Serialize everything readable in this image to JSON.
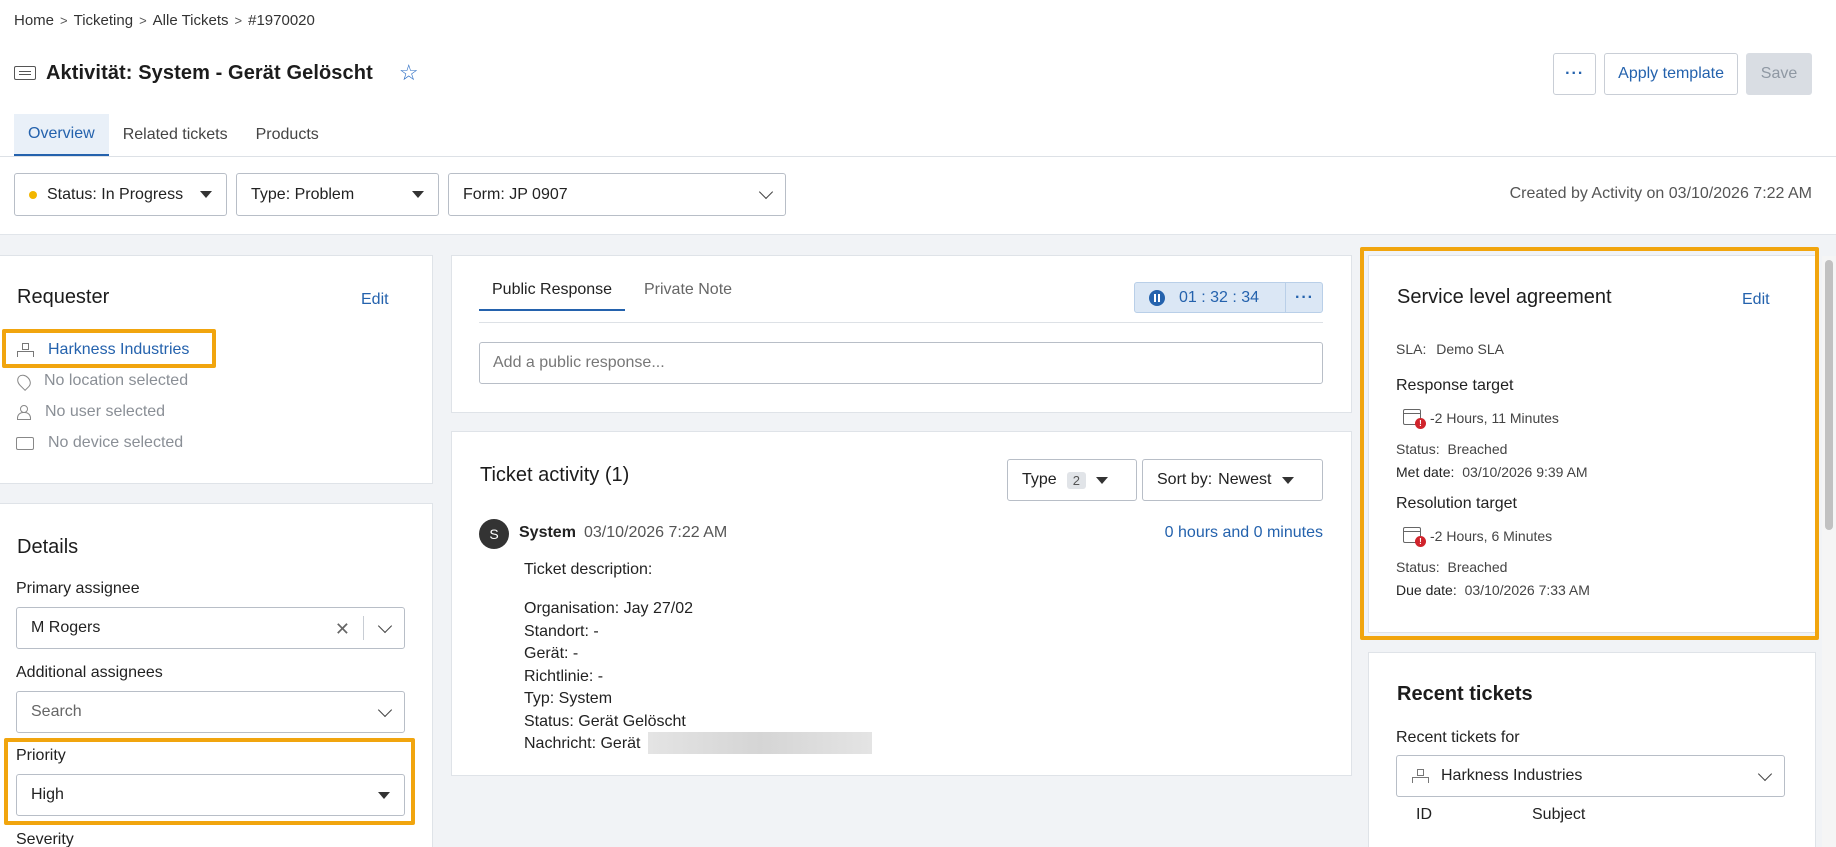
{
  "breadcrumb": [
    "Home",
    "Ticketing",
    "Alle Tickets",
    "#1970020"
  ],
  "title": "Aktivität: System - Gerät Gelöscht",
  "header_buttons": {
    "more": "···",
    "apply_template": "Apply template",
    "save": "Save"
  },
  "tabs": [
    "Overview",
    "Related tickets",
    "Products"
  ],
  "filters": {
    "status": "Status: In Progress",
    "type": "Type: Problem",
    "form": "Form: JP 0907"
  },
  "created_text": "Created by Activity on 03/10/2026 7:22 AM",
  "requester": {
    "heading": "Requester",
    "edit": "Edit",
    "organisation": "Harkness Industries",
    "location": "No location selected",
    "user": "No user selected",
    "device": "No device selected"
  },
  "details": {
    "heading": "Details",
    "primary_label": "Primary assignee",
    "primary_value": "M Rogers",
    "additional_label": "Additional assignees",
    "additional_placeholder": "Search",
    "priority_label": "Priority",
    "priority_value": "High",
    "severity_label": "Severity"
  },
  "response": {
    "tab_public": "Public Response",
    "tab_private": "Private Note",
    "timer": "01 : 32 : 34",
    "timer_more": "···",
    "placeholder": "Add a public response..."
  },
  "activity": {
    "heading": "Ticket activity (1)",
    "type_btn": "Type",
    "type_count": "2",
    "sort_label": "Sort by:",
    "sort_value": "Newest",
    "avatar": "S",
    "author": "System",
    "time": "03/10/2026 7:22 AM",
    "duration": "0 hours and 0 minutes",
    "lines": [
      "Ticket description:",
      "Organisation: Jay 27/02",
      "Standort: -",
      "Gerät: -",
      "Richtlinie: -",
      "Typ: System",
      "Status: Gerät Gelöscht",
      "Nachricht: Gerät"
    ]
  },
  "sla": {
    "heading": "Service level agreement",
    "edit": "Edit",
    "sla_label": "SLA:",
    "sla_value": "Demo SLA",
    "response_target": "Response target",
    "response_time": "-2 Hours, 11 Minutes",
    "response_status_label": "Status:",
    "response_status": "Breached",
    "met_label": "Met date:",
    "met_date": "03/10/2026 9:39 AM",
    "resolution_target": "Resolution target",
    "resolution_time": "-2 Hours, 6 Minutes",
    "resolution_status_label": "Status:",
    "resolution_status": "Breached",
    "due_label": "Due date:",
    "due_date": "03/10/2026 7:33 AM"
  },
  "recent": {
    "heading": "Recent tickets",
    "for_label": "Recent tickets for",
    "for_value": "Harkness Industries",
    "col_id": "ID",
    "col_subject": "Subject"
  },
  "colors": {
    "accent": "#2462ad",
    "highlight": "#f1a50e",
    "status_dot": "#f2b600",
    "breach": "#d0242c"
  }
}
